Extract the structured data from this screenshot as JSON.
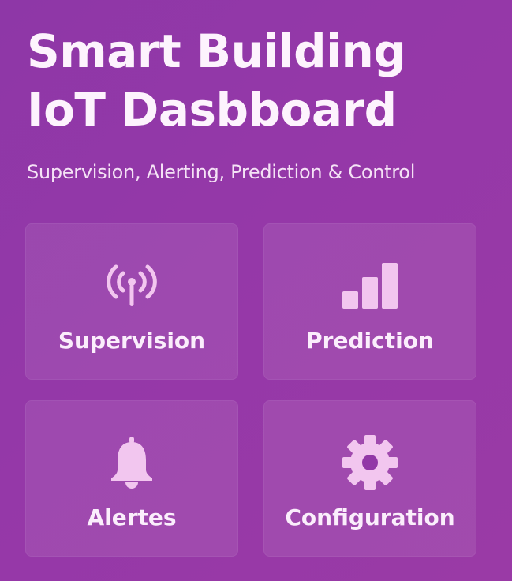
{
  "header": {
    "title_line1": "Smart Building",
    "title_line2": "IoT Dasbboard",
    "subtitle": "Supervision, Alerting, Prediction & Control"
  },
  "tiles": [
    {
      "label": "Supervision",
      "icon": "antenna-signal-icon"
    },
    {
      "label": "Prediction",
      "icon": "bar-chart-icon"
    },
    {
      "label": "Alertes",
      "icon": "bell-icon"
    },
    {
      "label": "Configuration",
      "icon": "gear-icon"
    }
  ],
  "colors": {
    "background_start": "#8e37a7",
    "background_end": "#9a3aa6",
    "icon_fill": "#f2c6ef",
    "text": "#fbeefc"
  }
}
